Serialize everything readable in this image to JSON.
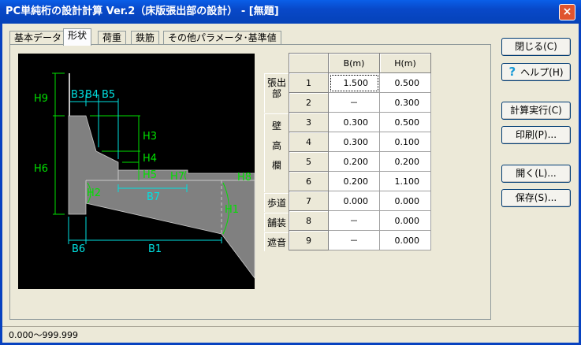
{
  "window": {
    "title": "PC単純桁の設計計算 Ver.2（床版張出部の設計） - [無題]",
    "close": "×"
  },
  "tabs": [
    "基本データ",
    "形状",
    "荷重",
    "鉄筋",
    "その他パラメータ･基準値"
  ],
  "drawing": {
    "labels": {
      "H9": "H9",
      "H6": "H6",
      "B3": "B3",
      "B4": "B4",
      "B5": "B5",
      "H3": "H3",
      "H4": "H4",
      "H5": "H5",
      "H7": "H7",
      "H8": "H8",
      "H2": "H2",
      "H1": "H1",
      "B7": "B7",
      "B6": "B6",
      "B1": "B1"
    }
  },
  "table": {
    "headers": [
      "",
      "B(m)",
      "H(m)"
    ],
    "groups": [
      "張出部",
      "壁高欄",
      "歩道",
      "舗装",
      "遮音"
    ],
    "rows": [
      [
        "1",
        "1.500",
        "0.500"
      ],
      [
        "2",
        "－",
        "0.300"
      ],
      [
        "3",
        "0.300",
        "0.500"
      ],
      [
        "4",
        "0.300",
        "0.100"
      ],
      [
        "5",
        "0.200",
        "0.200"
      ],
      [
        "6",
        "0.200",
        "1.100"
      ],
      [
        "7",
        "0.000",
        "0.000"
      ],
      [
        "8",
        "－",
        "0.000"
      ],
      [
        "9",
        "－",
        "0.000"
      ]
    ]
  },
  "buttons": {
    "close": "閉じる(C)",
    "help": "ヘルプ(H)",
    "run": "計算実行(C)",
    "print": "印刷(P)...",
    "open": "開く(L)...",
    "save": "保存(S)..."
  },
  "status": "0.000～999.999"
}
